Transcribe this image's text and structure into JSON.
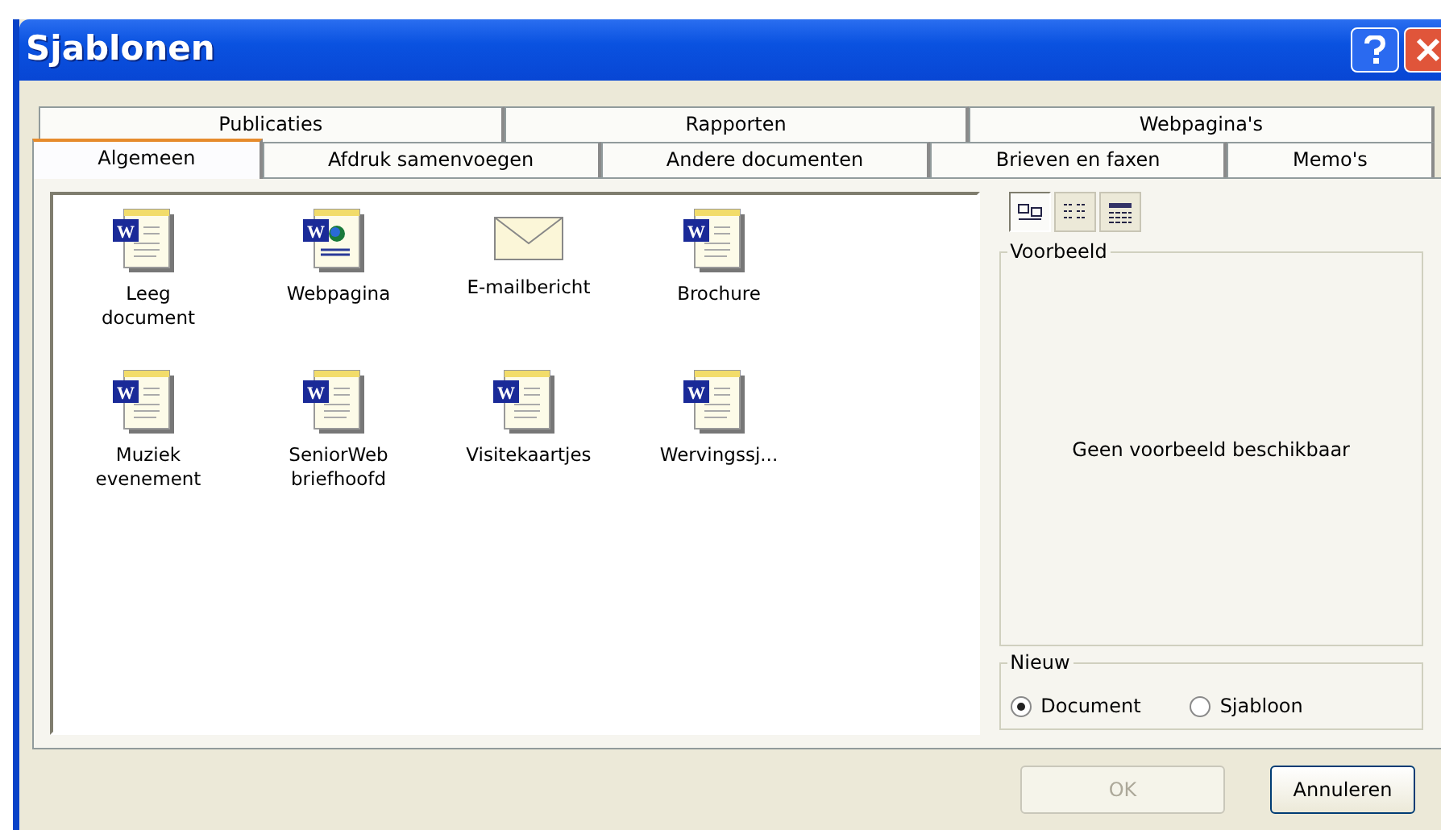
{
  "window": {
    "title": "Sjablonen"
  },
  "tab_rows": [
    [
      {
        "label": "Publicaties",
        "selected": false
      },
      {
        "label": "Rapporten",
        "selected": false
      },
      {
        "label": "Webpagina's",
        "selected": false
      }
    ],
    [
      {
        "label": "Algemeen",
        "selected": true
      },
      {
        "label": "Afdruk samenvoegen",
        "selected": false
      },
      {
        "label": "Andere documenten",
        "selected": false
      },
      {
        "label": "Brieven en faxen",
        "selected": false
      },
      {
        "label": "Memo's",
        "selected": false
      }
    ]
  ],
  "templates": [
    {
      "label": "Leeg document",
      "kind": "word",
      "icon_letter": "W"
    },
    {
      "label": "Webpagina",
      "kind": "web",
      "icon_letter": "W"
    },
    {
      "label": "E-mailbericht",
      "kind": "mail"
    },
    {
      "label": "Brochure",
      "kind": "word",
      "icon_letter": "W"
    },
    {
      "label": "Muziek evenement",
      "kind": "word",
      "icon_letter": "W"
    },
    {
      "label": "SeniorWeb briefhoofd",
      "kind": "word",
      "icon_letter": "W"
    },
    {
      "label": "Visitekaartjes",
      "kind": "word",
      "icon_letter": "W"
    },
    {
      "label": "Wervingssj...",
      "kind": "word",
      "icon_letter": "W"
    }
  ],
  "view_buttons": [
    {
      "kind": "icons",
      "selected": true
    },
    {
      "kind": "list",
      "selected": false
    },
    {
      "kind": "details",
      "selected": false
    }
  ],
  "preview": {
    "legend": "Voorbeeld",
    "message": "Geen voorbeeld beschikbaar"
  },
  "new_group": {
    "legend": "Nieuw",
    "options": [
      {
        "label": "Document",
        "selected": true
      },
      {
        "label": "Sjabloon",
        "selected": false
      }
    ]
  },
  "buttons": [
    {
      "label": "OK",
      "disabled": true
    },
    {
      "label": "Annuleren",
      "disabled": false
    }
  ]
}
